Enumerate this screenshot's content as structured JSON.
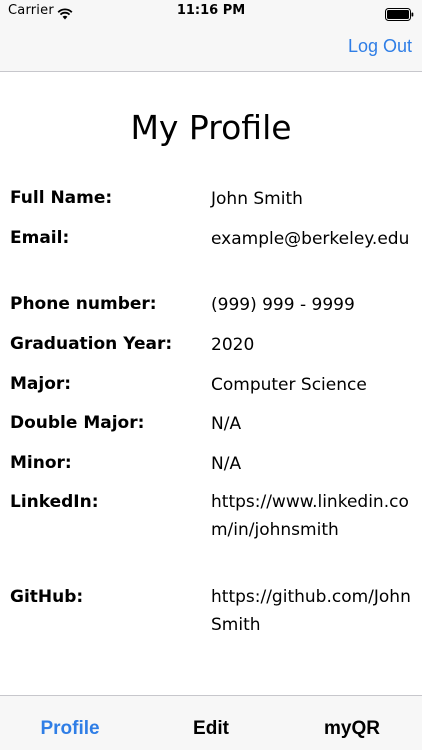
{
  "status": {
    "carrier": "Carrier",
    "time": "11:16 PM"
  },
  "nav": {
    "logout_label": "Log Out"
  },
  "page": {
    "title": "My Profile"
  },
  "fields": [
    {
      "label": "Full Name:",
      "value": "John Smith"
    },
    {
      "label": "Email:",
      "value": "example@berkeley.edu"
    },
    {
      "label": "Phone number:",
      "value": "(999) 999 - 9999"
    },
    {
      "label": "Graduation Year:",
      "value": "2020"
    },
    {
      "label": "Major:",
      "value": "Computer Science"
    },
    {
      "label": "Double Major:",
      "value": "N/A"
    },
    {
      "label": "Minor:",
      "value": "N/A"
    },
    {
      "label": "LinkedIn:",
      "value": "https://www.linkedin.com/in/johnsmith"
    },
    {
      "label": "GitHub:",
      "value": "https://github.com/JohnSmith"
    }
  ],
  "tabs": [
    {
      "label": "Profile"
    },
    {
      "label": "Edit"
    },
    {
      "label": "myQR"
    }
  ],
  "colors": {
    "accent": "#2f7ee6",
    "bar_background": "#f7f7f7"
  },
  "icons": {
    "wifi": "wifi-icon",
    "battery": "battery-icon"
  }
}
